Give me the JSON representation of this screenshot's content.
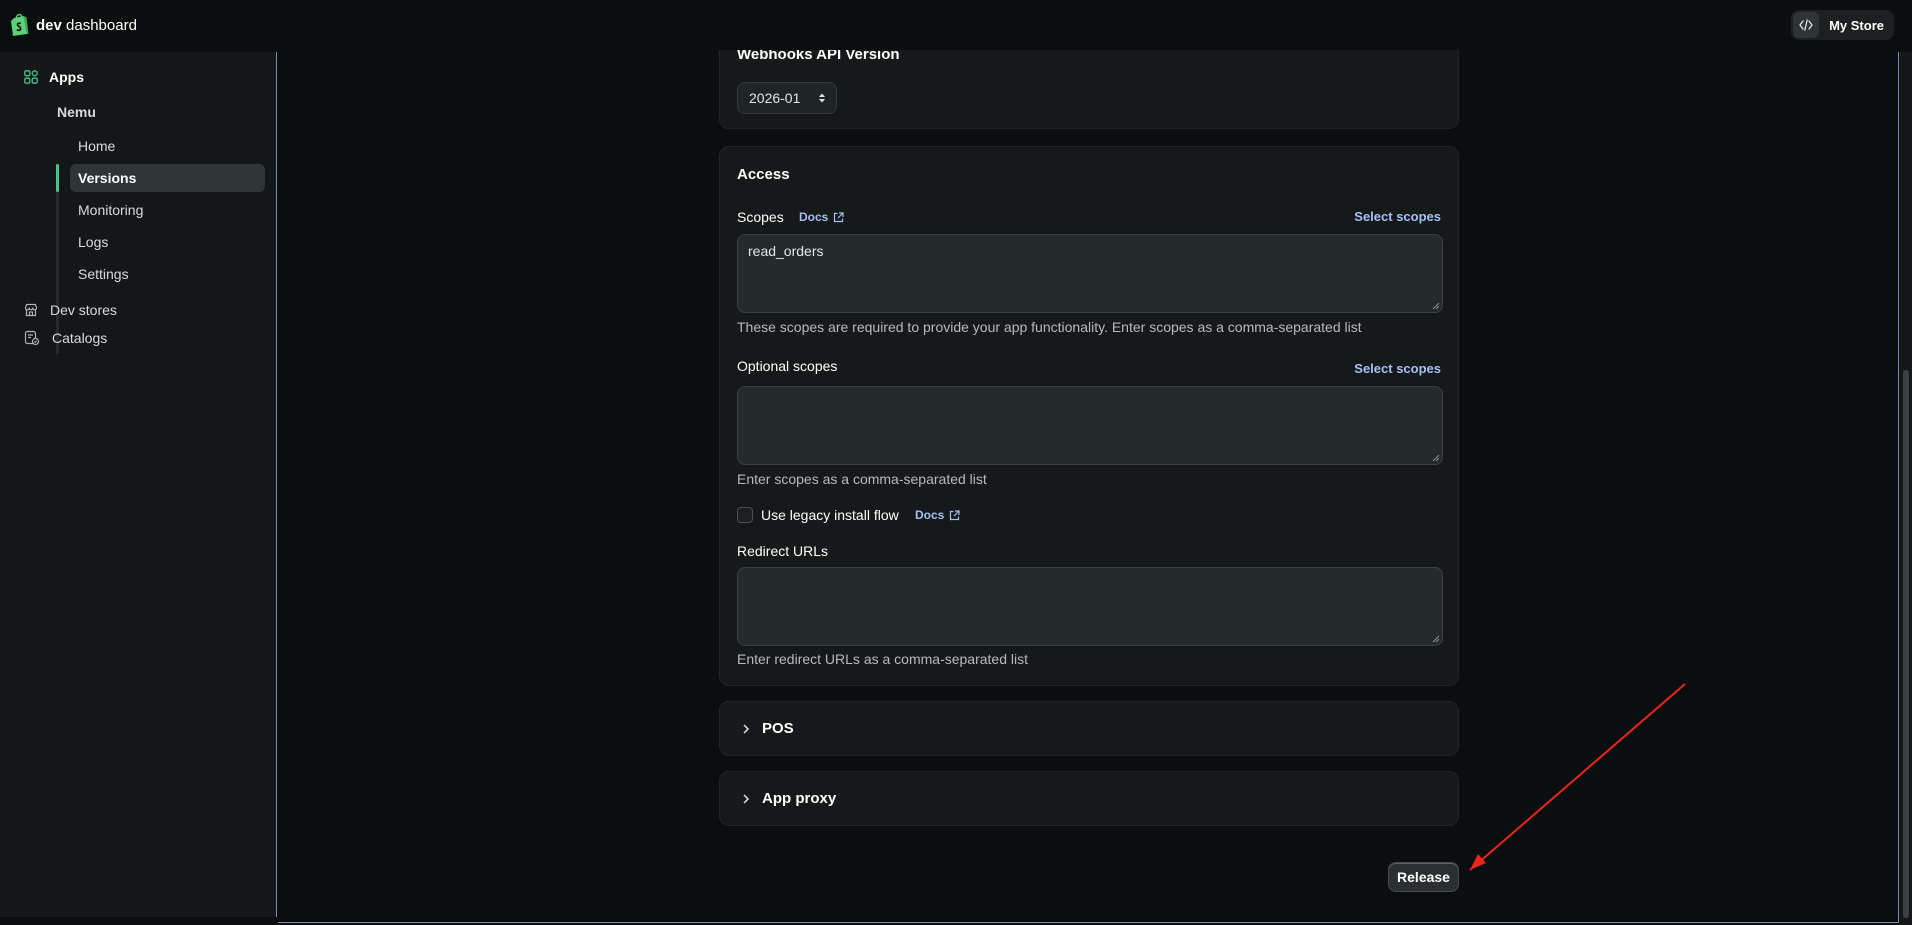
{
  "topbar": {
    "brand_bold": "dev",
    "brand_rest": " dashboard",
    "store_label": "My Store",
    "store_icon": "code-icon"
  },
  "sidebar": {
    "apps_label": "Apps",
    "app_name": "Nemu",
    "subnav": [
      {
        "label": "Home",
        "active": false
      },
      {
        "label": "Versions",
        "active": true
      },
      {
        "label": "Monitoring",
        "active": false
      },
      {
        "label": "Logs",
        "active": false
      },
      {
        "label": "Settings",
        "active": false
      }
    ],
    "items": [
      {
        "label": "Dev stores",
        "icon": "store-icon"
      },
      {
        "label": "Catalogs",
        "icon": "catalog-icon"
      }
    ]
  },
  "webhooks": {
    "heading": "Webhooks API Version",
    "version_value": "2026-01"
  },
  "access": {
    "heading": "Access",
    "scopes_label": "Scopes",
    "docs_label": "Docs",
    "select_scopes_label": "Select scopes",
    "scopes_value": "read_orders",
    "scopes_help": "These scopes are required to provide your app functionality. Enter scopes as a comma-separated list",
    "optional_label": "Optional scopes",
    "optional_select_label": "Select scopes",
    "optional_value": "",
    "optional_help": "Enter scopes as a comma-separated list",
    "legacy_label": "Use legacy install flow",
    "legacy_docs_label": "Docs",
    "legacy_checked": false,
    "redirect_label": "Redirect URLs",
    "redirect_value": "",
    "redirect_help": "Enter redirect URLs as a comma-separated list"
  },
  "sections": [
    {
      "title": "POS"
    },
    {
      "title": "App proxy"
    }
  ],
  "release_label": "Release",
  "colors": {
    "accent": "#4bc08f",
    "link": "#a5bff5",
    "annotation_arrow": "#e8261f"
  }
}
